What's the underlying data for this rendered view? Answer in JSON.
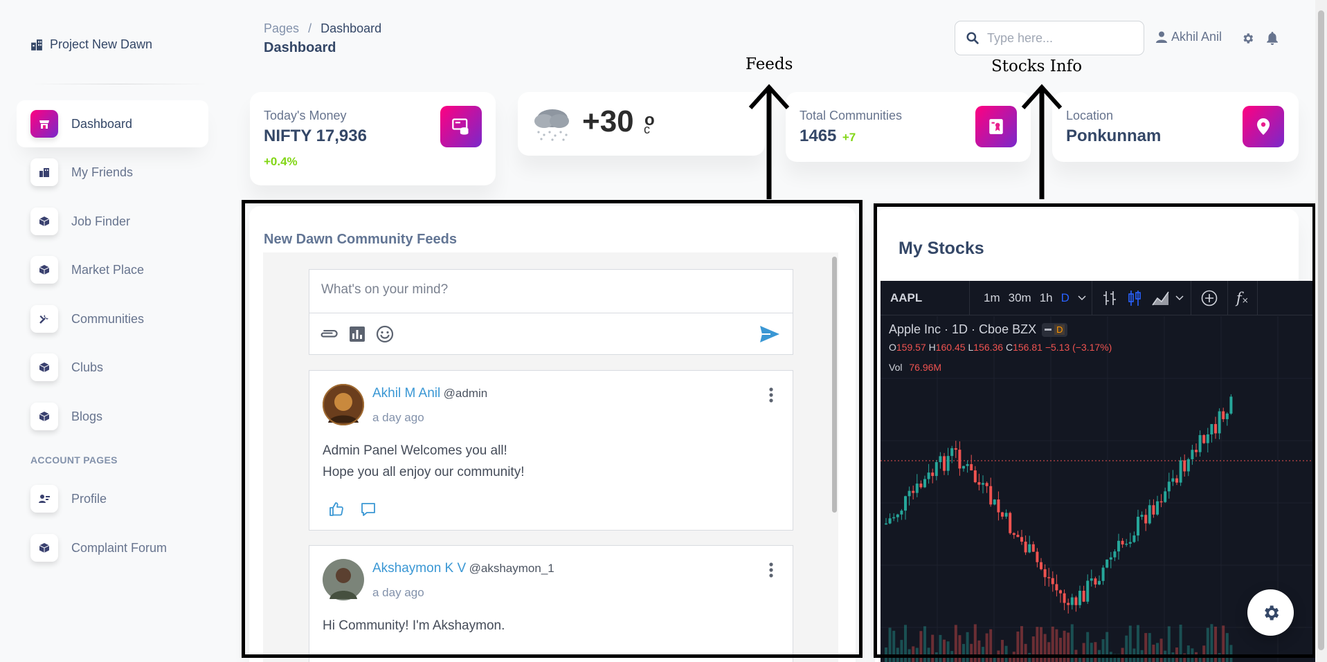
{
  "sidebar": {
    "brand": "Project New Dawn",
    "items": [
      {
        "label": "Dashboard",
        "icon": "shop-icon"
      },
      {
        "label": "My Friends",
        "icon": "office-icon"
      },
      {
        "label": "Job Finder",
        "icon": "box-icon"
      },
      {
        "label": "Market Place",
        "icon": "box-icon"
      },
      {
        "label": "Communities",
        "icon": "settings-icon"
      },
      {
        "label": "Clubs",
        "icon": "box-icon"
      },
      {
        "label": "Blogs",
        "icon": "box-icon"
      }
    ],
    "account_heading": "ACCOUNT PAGES",
    "account_items": [
      {
        "label": "Profile",
        "icon": "customer-support-icon"
      },
      {
        "label": "Complaint Forum",
        "icon": "box-icon"
      }
    ]
  },
  "header": {
    "breadcrumb_root": "Pages",
    "breadcrumb_sep": "/",
    "breadcrumb_current": "Dashboard",
    "page_title": "Dashboard",
    "search_placeholder": "Type here...",
    "user_name": "Akhil Anil"
  },
  "cards": {
    "money": {
      "label": "Today's Money",
      "value": "NIFTY 17,936",
      "change": "+0.4%"
    },
    "weather": {
      "temp": "+30",
      "degree": "o",
      "unit": "c"
    },
    "communities": {
      "label": "Total Communities",
      "value": "1465",
      "change": "+7"
    },
    "location": {
      "label": "Location",
      "value": "Ponkunnam"
    }
  },
  "annotations": {
    "feeds": "Feeds",
    "stocks": "Stocks Info"
  },
  "feeds": {
    "title": "New Dawn Community Feeds",
    "composer_placeholder": "What's on your mind?",
    "posts": [
      {
        "name": "Akhil M Anil",
        "handle": "@admin",
        "time": "a day ago",
        "lines": [
          "Admin Panel Welcomes you all!",
          "Hope you all enjoy our community!"
        ]
      },
      {
        "name": "Akshaymon K V",
        "handle": "@akshaymon_1",
        "time": "a day ago",
        "lines": [
          "Hi Community! I'm Akshaymon."
        ]
      }
    ]
  },
  "stocks": {
    "title": "My Stocks",
    "symbol": "AAPL",
    "intervals": [
      "1m",
      "30m",
      "1h",
      "D"
    ],
    "active_interval": "D",
    "instrument": "Apple Inc · 1D · Cboe BZX",
    "badge": "D",
    "ohlc": {
      "o_label": "O",
      "o": "159.57",
      "h_label": "H",
      "h": "160.45",
      "l_label": "L",
      "l": "156.36",
      "c_label": "C",
      "c": "156.81",
      "change": "−5.13 (−3.17%)"
    },
    "vol_label": "Vol",
    "vol": "76.96M",
    "fx_label": "f",
    "colors": {
      "up": "#26a69a",
      "down": "#ef5350",
      "bg": "#131722"
    }
  },
  "colors": {
    "accent_gradient_start": "#7928ca",
    "accent_gradient_end": "#ff0080",
    "link": "#3a97d4",
    "positive": "#82d616"
  }
}
